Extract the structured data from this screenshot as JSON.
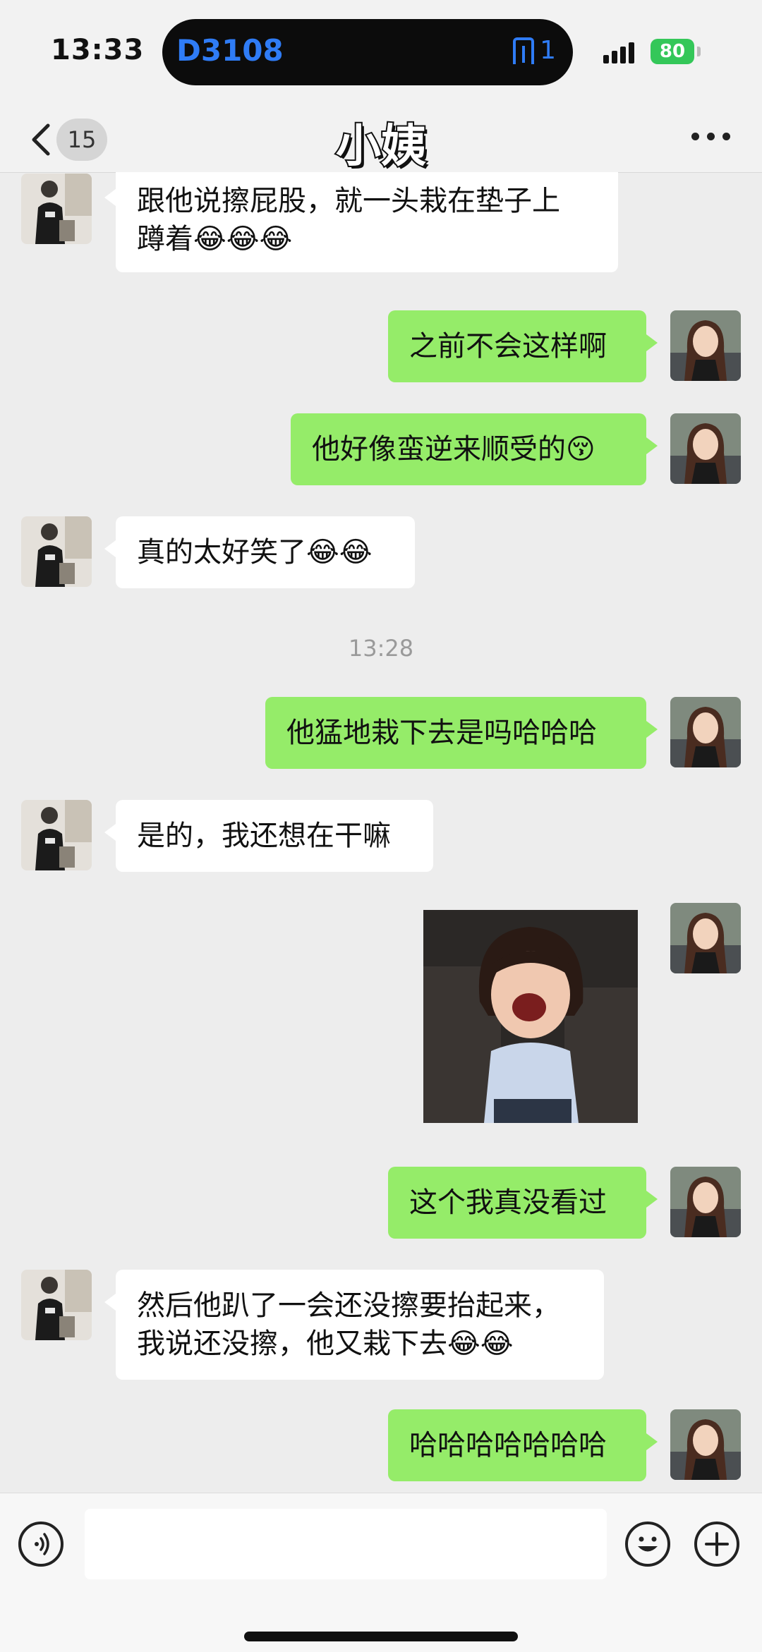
{
  "status_bar": {
    "time": "13:33",
    "train": "D3108",
    "gate": "1",
    "battery": "80"
  },
  "header": {
    "back_badge": "15",
    "title": "小姨"
  },
  "messages": [
    {
      "from": "other",
      "lines": [
        "跟他说擦屁股，就一头栽在垫子上",
        "蹲着😂😂😂"
      ]
    },
    {
      "from": "me",
      "lines": [
        "之前不会这样啊"
      ]
    },
    {
      "from": "me",
      "lines": [
        "他好像蛮逆来顺受的😚"
      ]
    },
    {
      "from": "other",
      "lines": [
        "真的太好笑了😂😂"
      ]
    },
    {
      "type": "timestamp",
      "text": "13:28"
    },
    {
      "from": "me",
      "lines": [
        "他猛地栽下去是吗哈哈哈"
      ]
    },
    {
      "from": "other",
      "lines": [
        "是的，我还想在干嘛"
      ]
    },
    {
      "from": "me",
      "type": "sticker",
      "desc": "laughing-girl-sticker"
    },
    {
      "from": "me",
      "lines": [
        "这个我真没看过"
      ]
    },
    {
      "from": "other",
      "lines": [
        "然后他趴了一会还没擦要抬起来，",
        "我说还没擦，他又栽下去😂😂"
      ]
    },
    {
      "from": "me",
      "lines": [
        "哈哈哈哈哈哈哈"
      ]
    }
  ],
  "input_bar": {
    "placeholder": ""
  },
  "colors": {
    "bg": "#ededed",
    "bubble_me": "#95ec69",
    "bubble_other": "#ffffff",
    "island_text": "#2f7cf6",
    "battery": "#34c759"
  },
  "icons": [
    "back-chevron-icon",
    "more-icon",
    "voice-icon",
    "emoji-icon",
    "plus-icon",
    "signal-icon",
    "battery-icon",
    "gate-icon"
  ]
}
